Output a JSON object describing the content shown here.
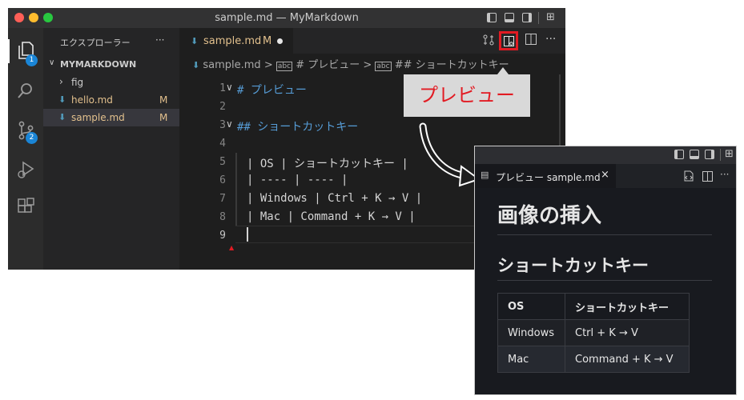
{
  "window": {
    "title": "sample.md — MyMarkdown",
    "traffic_colors": [
      "#ff5f57",
      "#febc2e",
      "#28c840"
    ]
  },
  "activity_bar": {
    "explorer_badge": "1",
    "source_control_badge": "2"
  },
  "sidebar": {
    "header": "エクスプローラー",
    "more": "···",
    "project": "MYMARKDOWN",
    "items": [
      {
        "label": "fig",
        "status": ""
      },
      {
        "label": "hello.md",
        "status": "M"
      },
      {
        "label": "sample.md",
        "status": "M"
      }
    ]
  },
  "editor": {
    "tab_label": "sample.md",
    "tab_status": "M",
    "breadcrumb": {
      "file": "sample.md",
      "sep": ">",
      "h1": "# プレビュー",
      "h2": "## ショートカットキー"
    },
    "lines": [
      {
        "n": "1",
        "text": "# プレビュー"
      },
      {
        "n": "2",
        "text": ""
      },
      {
        "n": "3",
        "text": "## ショートカットキー"
      },
      {
        "n": "4",
        "text": ""
      },
      {
        "n": "5",
        "text": "| OS | ショートカットキー |"
      },
      {
        "n": "6",
        "text": "| ---- | ---- |"
      },
      {
        "n": "7",
        "text": "| Windows | Ctrl + K → V |"
      },
      {
        "n": "8",
        "text": "| Mac | Command + K → V |"
      },
      {
        "n": "9",
        "text": ""
      }
    ]
  },
  "callout": {
    "label": "プレビュー",
    "accent": "#e21b23"
  },
  "preview": {
    "tab_label": "プレビュー sample.md",
    "h1": "画像の挿入",
    "h2": "ショートカットキー",
    "table": {
      "headers": [
        "OS",
        "ショートカットキー"
      ],
      "rows": [
        [
          "Windows",
          "Ctrl + K → V"
        ],
        [
          "Mac",
          "Command + K → V"
        ]
      ]
    }
  }
}
